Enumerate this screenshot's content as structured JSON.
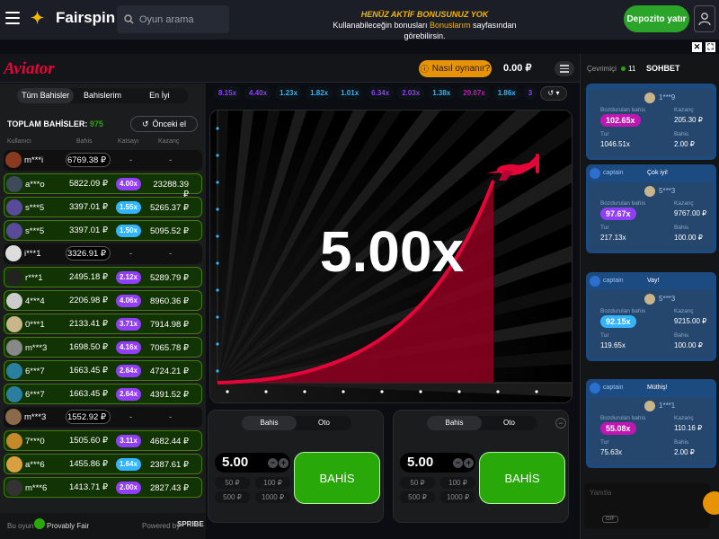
{
  "site": {
    "logo_text": "Fairspin",
    "search_placeholder": "Oyun arama",
    "promo_line1": "HENÜZ AKTİF BONUSUNUZ YOK",
    "promo_line2a": "Kullanabileceğin bonusları ",
    "promo_line2b": "Bonuslarım",
    "promo_line2c": " sayfasından görebilirsin.",
    "deposit_label": "Depozito yatır"
  },
  "game": {
    "logo": "Aviator",
    "howto_label": "Nasıl oynanır?",
    "balance": "0.00 ₽",
    "multiplier": "5.00x"
  },
  "bets_panel": {
    "tabs": [
      "Tüm Bahisler",
      "Bahislerim",
      "En İyi"
    ],
    "total_label": "TOPLAM BAHİSLER:",
    "total_count": "975",
    "prev_label": "Önceki el",
    "col_user": "Kullanıcı",
    "col_bet": "Bahis",
    "col_mult": "Katsayı",
    "col_win": "Kazanç",
    "rows": [
      {
        "user": "m***i",
        "bet": "6769.38 ₽",
        "mult": "-",
        "win": "-",
        "won": false,
        "avatar": "#8a3a1f"
      },
      {
        "user": "a***o",
        "bet": "5822.09 ₽",
        "mult": "4.00x",
        "win": "23288.39 ₽",
        "won": true,
        "avatar": "#3c4a5a"
      },
      {
        "user": "s***5",
        "bet": "3397.01 ₽",
        "mult": "1.55x",
        "win": "5265.37 ₽",
        "won": true,
        "avatar": "#5a4a9a"
      },
      {
        "user": "s***5",
        "bet": "3397.01 ₽",
        "mult": "1.50x",
        "win": "5095.52 ₽",
        "won": true,
        "avatar": "#5a4a9a"
      },
      {
        "user": "i***1",
        "bet": "3326.91 ₽",
        "mult": "-",
        "win": "-",
        "won": false,
        "avatar": "#ddd"
      },
      {
        "user": "r***1",
        "bet": "2495.18 ₽",
        "mult": "2.12x",
        "win": "5289.79 ₽",
        "won": true,
        "avatar": "#222"
      },
      {
        "user": "4***4",
        "bet": "2206.98 ₽",
        "mult": "4.06x",
        "win": "8960.36 ₽",
        "won": true,
        "avatar": "#ccc"
      },
      {
        "user": "0***1",
        "bet": "2133.41 ₽",
        "mult": "3.71x",
        "win": "7914.98 ₽",
        "won": true,
        "avatar": "#c9b58a"
      },
      {
        "user": "m***3",
        "bet": "1698.50 ₽",
        "mult": "4.16x",
        "win": "7065.78 ₽",
        "won": true,
        "avatar": "#888"
      },
      {
        "user": "6***7",
        "bet": "1663.45 ₽",
        "mult": "2.64x",
        "win": "4724.21 ₽",
        "won": true,
        "avatar": "#2a7fa0"
      },
      {
        "user": "6***7",
        "bet": "1663.45 ₽",
        "mult": "2.64x",
        "win": "4391.52 ₽",
        "won": true,
        "avatar": "#2a7fa0"
      },
      {
        "user": "m***3",
        "bet": "1552.92 ₽",
        "mult": "-",
        "win": "-",
        "won": false,
        "avatar": "#8a6a4a"
      },
      {
        "user": "7***0",
        "bet": "1505.60 ₽",
        "mult": "3.11x",
        "win": "4682.44 ₽",
        "won": true,
        "avatar": "#c48a2a"
      },
      {
        "user": "a***6",
        "bet": "1455.86 ₽",
        "mult": "1.64x",
        "win": "2387.61 ₽",
        "won": true,
        "avatar": "#d8a040"
      },
      {
        "user": "m***6",
        "bet": "1413.71 ₽",
        "mult": "2.00x",
        "win": "2827.43 ₽",
        "won": true,
        "avatar": "#333"
      }
    ],
    "footer_provably": "Bu oyun",
    "footer_pf": "Provably Fair",
    "footer_powered": "Powered by",
    "footer_brand": "SPRIBE"
  },
  "history": [
    {
      "v": "8.15x",
      "c": "#913ef8"
    },
    {
      "v": "4.40x",
      "c": "#913ef8"
    },
    {
      "v": "1.23x",
      "c": "#34b4ff"
    },
    {
      "v": "1.82x",
      "c": "#34b4ff"
    },
    {
      "v": "1.01x",
      "c": "#34b4ff"
    },
    {
      "v": "6.34x",
      "c": "#913ef8"
    },
    {
      "v": "2.03x",
      "c": "#913ef8"
    },
    {
      "v": "1.38x",
      "c": "#34b4ff"
    },
    {
      "v": "29.87x",
      "c": "#c017b4"
    },
    {
      "v": "1.86x",
      "c": "#34b4ff"
    },
    {
      "v": "3",
      "c": "#913ef8"
    }
  ],
  "bet_controls": [
    {
      "tab_bet": "Bahis",
      "tab_auto": "Oto",
      "amount": "5.00",
      "quick": [
        "50 ₽",
        "100 ₽",
        "500 ₽",
        "1000 ₽"
      ],
      "button": "BAHİS"
    },
    {
      "tab_bet": "Bahis",
      "tab_auto": "Oto",
      "amount": "5.00",
      "quick": [
        "50 ₽",
        "100 ₽",
        "500 ₽",
        "1000 ₽"
      ],
      "button": "BAHİS"
    }
  ],
  "chat": {
    "online_label": "Çevrimiçi",
    "online_count": "11",
    "title": "SOHBET",
    "cards": [
      {
        "author": "",
        "text": "",
        "user": "1***9",
        "cashout_label": "Bozdurulan bahis",
        "cashout": "102.65x",
        "win_label": "Kazanç",
        "win": "205.30 ₽",
        "odds_label": "Tur",
        "odds": "1046.51x",
        "bet_label": "Bahis",
        "bet": "2.00 ₽",
        "pill": "#c017b4"
      },
      {
        "author": "captain",
        "text": "Çok iyi!",
        "user": "5***3",
        "cashout_label": "Bozdurulan bahis",
        "cashout": "97.67x",
        "win_label": "Kazanç",
        "win": "9767.00 ₽",
        "odds_label": "Tur",
        "odds": "217.13x",
        "bet_label": "Bahis",
        "bet": "100.00 ₽",
        "pill": "#913ef8"
      },
      {
        "author": "captain",
        "text": "Vay!",
        "user": "5***3",
        "cashout_label": "Bozdurulan bahis",
        "cashout": "92.15x",
        "win_label": "Kazanç",
        "win": "9215.00 ₽",
        "odds_label": "Tur",
        "odds": "119.65x",
        "bet_label": "Bahis",
        "bet": "100.00 ₽",
        "pill": "#34b4ff"
      },
      {
        "author": "captain",
        "text": "Müthiş!",
        "user": "1***1",
        "cashout_label": "Bozdurulan bahis",
        "cashout": "55.08x",
        "win_label": "Kazanç",
        "win": "110.16 ₽",
        "odds_label": "Tur",
        "odds": "75.63x",
        "bet_label": "Bahis",
        "bet": "2.00 ₽",
        "pill": "#c017b4"
      }
    ],
    "input_placeholder": "Yanıtla",
    "gif_label": "GIF"
  }
}
